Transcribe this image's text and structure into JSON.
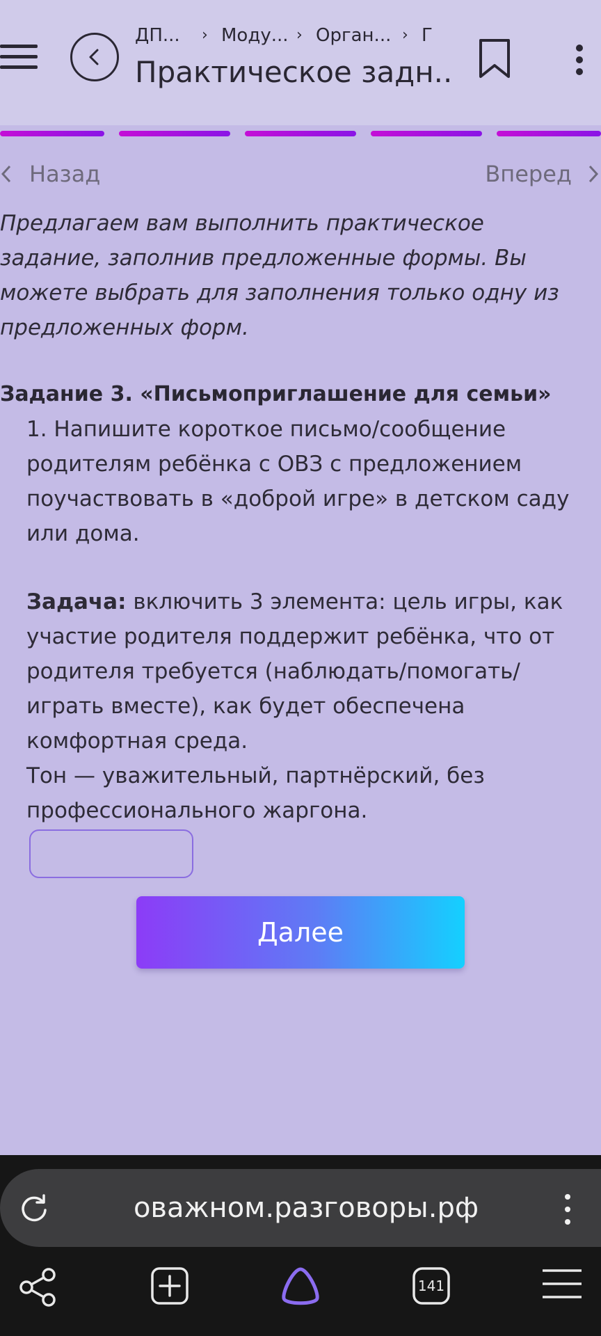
{
  "header": {
    "breadcrumbs": [
      "ДП...",
      "Моду...",
      "Орган...",
      "Г"
    ],
    "title": "Практическое задн..."
  },
  "progress": {
    "segments_total": 5,
    "segments_completed": 5,
    "color": "#b311dc"
  },
  "nav": {
    "back_label": "Назад",
    "forward_label": "Вперед"
  },
  "content": {
    "intro": "Предлагаем вам выполнить практическое задание, заполнив предложенные формы. Вы можете выбрать для заполнения только одну из предложенных форм.",
    "task_title": "Задание 3. «Письмоприглашение для семьи»",
    "item1": "1. Напишите короткое письмо/сообщение родителям ребёнка с ОВЗ с предложением поучаствовать в «доброй игре» в детском саду или дома.",
    "goal_label": "Задача:",
    "goal_text": " включить 3 элемента: цель игры, как участие родителя поддержит ребёнка, что от родителя требуется (наблюдать/помогать/играть вместе), как будет обеспечена комфортная среда.",
    "tone_text": "Тон — уважительный, партнёрский, без профессионального жаргона.",
    "answer_value": "",
    "next_label": "Далее"
  },
  "browser": {
    "url": "оважном.разговоры.рф",
    "tab_count": "141"
  },
  "colors": {
    "page_bg": "#c4bbe6",
    "header_bg": "#d0cbea",
    "accent_gradient_start": "#8c3cf7",
    "accent_gradient_end": "#14d0ff",
    "browser_bar": "#161616",
    "alice_icon": "#8b6cf0"
  },
  "icons": [
    "menu-icon",
    "back-arrow-icon",
    "bookmark-icon",
    "more-vertical-icon",
    "chevron-left-icon",
    "chevron-right-icon",
    "reload-icon",
    "share-icon",
    "new-tab-icon",
    "alice-assistant-icon",
    "tabs-icon",
    "browser-menu-icon"
  ]
}
